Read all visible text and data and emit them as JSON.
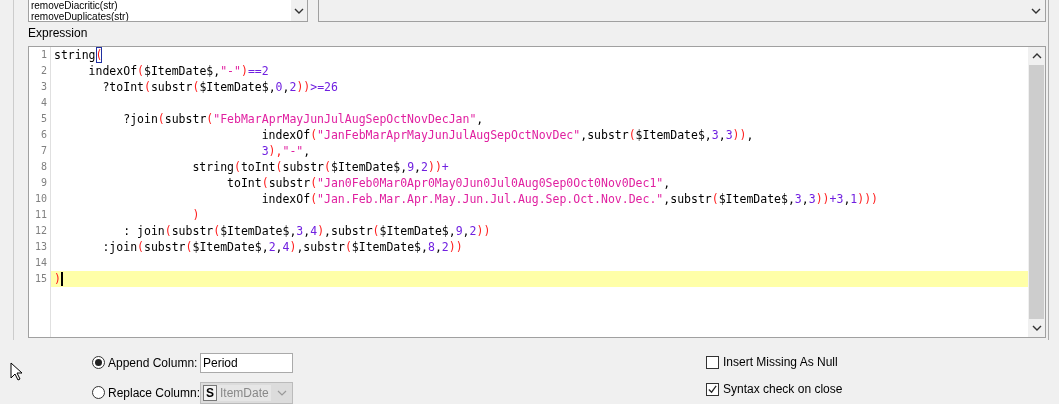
{
  "function_list": {
    "items": [
      "removeDiacritic(str)",
      "removeDuplicates(str)"
    ]
  },
  "expression": {
    "label": "Expression",
    "lines": [
      {
        "number": "1",
        "current": false,
        "tokens": [
          {
            "kind": "text",
            "text": "string"
          },
          {
            "kind": "match",
            "text": "("
          }
        ]
      },
      {
        "number": "2",
        "current": false,
        "tokens": [
          {
            "kind": "text",
            "text": "     indexOf"
          },
          {
            "kind": "paren",
            "text": "("
          },
          {
            "kind": "text",
            "text": "$ItemDate$,"
          },
          {
            "kind": "str",
            "text": "\"-\""
          },
          {
            "kind": "paren",
            "text": ")"
          },
          {
            "kind": "num",
            "text": "==2"
          }
        ]
      },
      {
        "number": "3",
        "current": false,
        "tokens": [
          {
            "kind": "text",
            "text": "       ?toInt"
          },
          {
            "kind": "paren",
            "text": "("
          },
          {
            "kind": "text",
            "text": "substr"
          },
          {
            "kind": "paren",
            "text": "("
          },
          {
            "kind": "text",
            "text": "$ItemDate$,"
          },
          {
            "kind": "num",
            "text": "0"
          },
          {
            "kind": "text",
            "text": ","
          },
          {
            "kind": "num",
            "text": "2"
          },
          {
            "kind": "paren",
            "text": "))"
          },
          {
            "kind": "num",
            "text": ">=26"
          }
        ]
      },
      {
        "number": "4",
        "current": false
      },
      {
        "number": "5",
        "current": false,
        "tokens": [
          {
            "kind": "text",
            "text": "          ?join"
          },
          {
            "kind": "paren",
            "text": "("
          },
          {
            "kind": "text",
            "text": "substr"
          },
          {
            "kind": "paren",
            "text": "("
          },
          {
            "kind": "str",
            "text": "\"FebMarAprMayJunJulAugSepOctNovDecJan\""
          },
          {
            "kind": "text",
            "text": ","
          }
        ]
      },
      {
        "number": "6",
        "current": false,
        "tokens": [
          {
            "kind": "text",
            "text": "                              indexOf"
          },
          {
            "kind": "paren",
            "text": "("
          },
          {
            "kind": "str",
            "text": "\"JanFebMarAprMayJunJulAugSepOctNovDec\""
          },
          {
            "kind": "text",
            "text": ",substr"
          },
          {
            "kind": "paren",
            "text": "("
          },
          {
            "kind": "text",
            "text": "$ItemDate$,"
          },
          {
            "kind": "num",
            "text": "3"
          },
          {
            "kind": "text",
            "text": ","
          },
          {
            "kind": "num",
            "text": "3"
          },
          {
            "kind": "paren",
            "text": "))"
          },
          {
            "kind": "text",
            "text": ","
          }
        ]
      },
      {
        "number": "7",
        "current": false,
        "tokens": [
          {
            "kind": "num",
            "text": "                              3"
          },
          {
            "kind": "paren",
            "text": "),"
          },
          {
            "kind": "str",
            "text": "\"-\""
          },
          {
            "kind": "text",
            "text": ","
          }
        ]
      },
      {
        "number": "8",
        "current": false,
        "tokens": [
          {
            "kind": "text",
            "text": "                    string"
          },
          {
            "kind": "paren",
            "text": "("
          },
          {
            "kind": "text",
            "text": "toInt"
          },
          {
            "kind": "paren",
            "text": "("
          },
          {
            "kind": "text",
            "text": "substr"
          },
          {
            "kind": "paren",
            "text": "("
          },
          {
            "kind": "text",
            "text": "$ItemDate$,"
          },
          {
            "kind": "num",
            "text": "9"
          },
          {
            "kind": "text",
            "text": ","
          },
          {
            "kind": "num",
            "text": "2"
          },
          {
            "kind": "paren",
            "text": "))"
          },
          {
            "kind": "num",
            "text": "+"
          }
        ]
      },
      {
        "number": "9",
        "current": false,
        "tokens": [
          {
            "kind": "text",
            "text": "                         toInt"
          },
          {
            "kind": "paren",
            "text": "("
          },
          {
            "kind": "text",
            "text": "substr"
          },
          {
            "kind": "paren",
            "text": "("
          },
          {
            "kind": "str",
            "text": "\"Jan0Feb0Mar0Apr0May0Jun0Jul0Aug0Sep0Oct0Nov0Dec1\""
          },
          {
            "kind": "text",
            "text": ","
          }
        ]
      },
      {
        "number": "10",
        "current": false,
        "tokens": [
          {
            "kind": "text",
            "text": "                              indexOf"
          },
          {
            "kind": "paren",
            "text": "("
          },
          {
            "kind": "str",
            "text": "\"Jan.Feb.Mar.Apr.May.Jun.Jul.Aug.Sep.Oct.Nov.Dec.\""
          },
          {
            "kind": "text",
            "text": ",substr"
          },
          {
            "kind": "paren",
            "text": "("
          },
          {
            "kind": "text",
            "text": "$ItemDate$,"
          },
          {
            "kind": "num",
            "text": "3"
          },
          {
            "kind": "text",
            "text": ","
          },
          {
            "kind": "num",
            "text": "3"
          },
          {
            "kind": "paren",
            "text": "))"
          },
          {
            "kind": "num",
            "text": "+3"
          },
          {
            "kind": "text",
            "text": ","
          },
          {
            "kind": "num",
            "text": "1"
          },
          {
            "kind": "paren",
            "text": ")))"
          }
        ]
      },
      {
        "number": "11",
        "current": false,
        "tokens": [
          {
            "kind": "paren",
            "text": "                    )"
          }
        ]
      },
      {
        "number": "12",
        "current": false,
        "tokens": [
          {
            "kind": "text",
            "text": "          : join"
          },
          {
            "kind": "paren",
            "text": "("
          },
          {
            "kind": "text",
            "text": "substr"
          },
          {
            "kind": "paren",
            "text": "("
          },
          {
            "kind": "text",
            "text": "$ItemDate$,"
          },
          {
            "kind": "num",
            "text": "3"
          },
          {
            "kind": "text",
            "text": ","
          },
          {
            "kind": "num",
            "text": "4"
          },
          {
            "kind": "paren",
            "text": ")"
          },
          {
            "kind": "text",
            "text": ",substr"
          },
          {
            "kind": "paren",
            "text": "("
          },
          {
            "kind": "text",
            "text": "$ItemDate$,"
          },
          {
            "kind": "num",
            "text": "9"
          },
          {
            "kind": "text",
            "text": ","
          },
          {
            "kind": "num",
            "text": "2"
          },
          {
            "kind": "paren",
            "text": "))"
          }
        ]
      },
      {
        "number": "13",
        "current": false,
        "tokens": [
          {
            "kind": "text",
            "text": "       :join"
          },
          {
            "kind": "paren",
            "text": "("
          },
          {
            "kind": "text",
            "text": "substr"
          },
          {
            "kind": "paren",
            "text": "("
          },
          {
            "kind": "text",
            "text": "$ItemDate$,"
          },
          {
            "kind": "num",
            "text": "2"
          },
          {
            "kind": "text",
            "text": ","
          },
          {
            "kind": "num",
            "text": "4"
          },
          {
            "kind": "paren",
            "text": ")"
          },
          {
            "kind": "text",
            "text": ",substr"
          },
          {
            "kind": "paren",
            "text": "("
          },
          {
            "kind": "text",
            "text": "$ItemDate$,"
          },
          {
            "kind": "num",
            "text": "8"
          },
          {
            "kind": "text",
            "text": ","
          },
          {
            "kind": "num",
            "text": "2"
          },
          {
            "kind": "paren",
            "text": "))"
          }
        ]
      },
      {
        "number": "14",
        "current": false
      },
      {
        "number": "15",
        "current": true,
        "tokens": [
          {
            "kind": "paren",
            "text": ")"
          }
        ]
      }
    ]
  },
  "output_options": [
    {
      "kind": "append",
      "label": "Append Column:",
      "selected": true,
      "field": {
        "value": "Period"
      }
    },
    {
      "kind": "replace",
      "label": "Replace Column:",
      "selected": false,
      "column_select": {
        "type_badge": "S",
        "value": "ItemDate",
        "disabled": true
      }
    }
  ],
  "checkboxes": [
    {
      "label": "Insert Missing As Null",
      "checked": false
    },
    {
      "label": "Syntax check on close",
      "checked": true
    }
  ]
}
